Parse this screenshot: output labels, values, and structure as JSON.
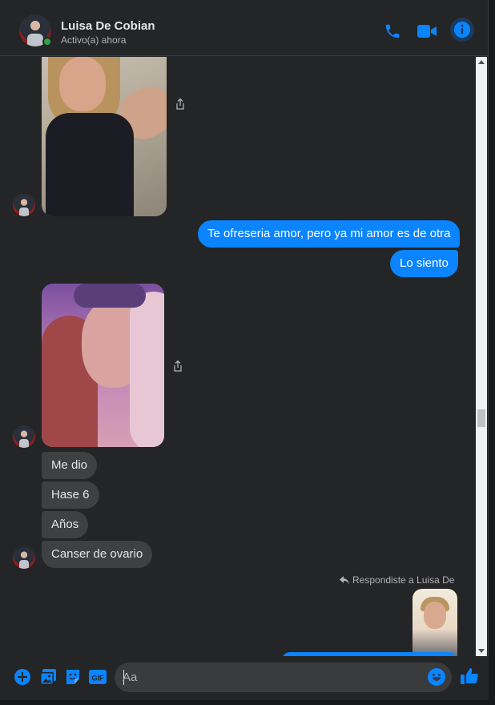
{
  "header": {
    "name": "Luisa De Cobian",
    "status": "Activo(a) ahora",
    "icons": [
      "phone-icon",
      "video-icon",
      "info-icon"
    ]
  },
  "messages": {
    "outgoing": [
      "Te ofreseria amor, pero ya mi amor es de otra",
      "Lo siento"
    ],
    "incoming": [
      "Me dio",
      "Hase 6",
      "Años",
      "Canser de ovario"
    ],
    "reply_note": "Respondiste a Luisa De"
  },
  "composer": {
    "placeholder": "Aa",
    "icons": [
      "plus-icon",
      "image-icon",
      "sticker-icon",
      "gif-icon",
      "emoji-icon",
      "thumbs-up-icon"
    ],
    "gif_label": "GIF"
  },
  "colors": {
    "accent": "#0a84ff",
    "background": "#242526",
    "incoming_bubble": "#3e4042",
    "online": "#31a24c"
  }
}
